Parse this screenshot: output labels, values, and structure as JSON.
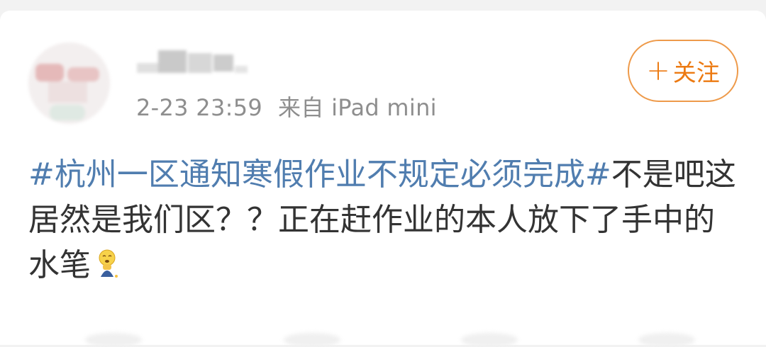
{
  "post": {
    "timestamp": "2-23 23:59",
    "source": "来自 iPad mini",
    "follow_label": "关注",
    "hashtag": "#杭州一区通知寒假作业不规定必须完成#",
    "text": "不是吧这居然是我们区？？正在赶作业的本人放下了手中的水笔",
    "emoji_icon": "crying-face-figure-icon"
  },
  "colors": {
    "hashtag": "#507daf",
    "follow_accent": "#ec7a12",
    "meta": "#8e8e8e",
    "body_text": "#333333"
  }
}
